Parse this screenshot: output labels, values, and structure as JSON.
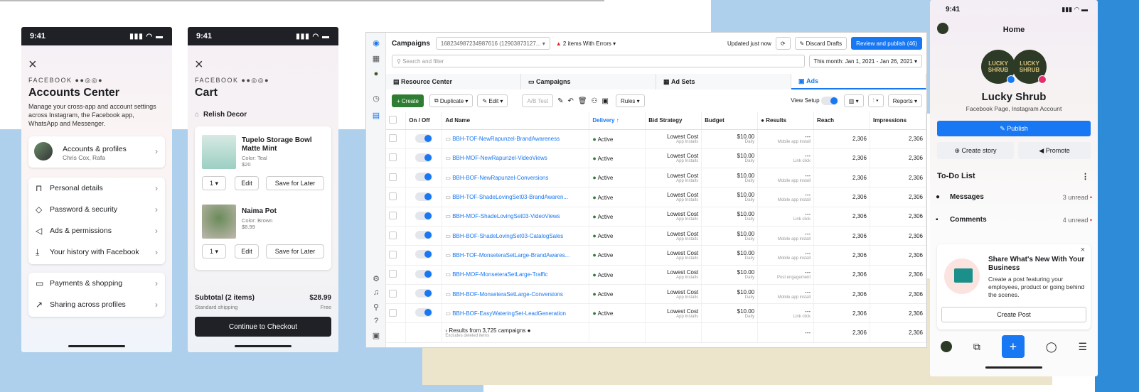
{
  "colors": {
    "accent": "#1877f2",
    "dark": "#1f2126",
    "bg_blue": "#aed0ec",
    "beige": "#ece5cc"
  },
  "phone1": {
    "time": "9:41",
    "brand": "FACEBOOK",
    "title": "Accounts Center",
    "description": "Manage your cross-app and account settings across Instagram, the Facebook app, WhatsApp and Messenger.",
    "profile": {
      "label": "Accounts & profiles",
      "sub": "Chris Cox, Rafa"
    },
    "items": [
      {
        "label": "Personal details",
        "icon": "id-card-icon"
      },
      {
        "label": "Password & security",
        "icon": "shield-icon"
      },
      {
        "label": "Ads & permissions",
        "icon": "megaphone-icon"
      },
      {
        "label": "Your history with Facebook",
        "icon": "download-icon"
      }
    ],
    "items2": [
      {
        "label": "Payments & shopping",
        "icon": "card-icon"
      },
      {
        "label": "Sharing across profiles",
        "icon": "share-icon"
      }
    ]
  },
  "phone2": {
    "time": "9:41",
    "brand": "FACEBOOK",
    "title": "Cart",
    "shop": "Relish Decor",
    "items": [
      {
        "name": "Tupelo Storage Bowl Matte Mint",
        "color": "Color: Teal",
        "price": "$20",
        "qty": "1"
      },
      {
        "name": "Naima Pot",
        "color": "Color: Brown",
        "price": "$8.99",
        "qty": "1"
      }
    ],
    "edit_label": "Edit",
    "save_label": "Save for Later",
    "subtotal_label": "Subtotal (2 items)",
    "subtotal_value": "$28.99",
    "shipping_label": "Standard shipping",
    "shipping_value": "Free",
    "checkout_label": "Continue to Checkout"
  },
  "ads": {
    "campaigns_label": "Campaigns",
    "account_id": "1682349872349876​16 (12903873127...",
    "errors_label": "2 items With Errors",
    "updated_label": "Updated just now",
    "discard_label": "Discard Drafts",
    "publish_label": "Review and publish (46)",
    "search_placeholder": "Search and filter",
    "date_range": "This month: Jan 1, 2021 - Jan 26, 2021",
    "tabs": [
      "Resource Center",
      "Campaigns",
      "Ad Sets",
      "Ads"
    ],
    "create_label": "+ Create",
    "duplicate_label": "Duplicate",
    "edit_label": "Edit",
    "ab_label": "A/B Test",
    "rules_label": "Rules",
    "view_setup_label": "View Setup",
    "reports_label": "Reports",
    "columns": [
      "On / Off",
      "Ad Name",
      "Delivery ↑",
      "Bid Strategy",
      "Budget",
      "Results",
      "Reach",
      "Impressions"
    ],
    "rows": [
      {
        "name": "BBH-TOF-NewRapunzel-BrandAwareness",
        "delivery": "Active",
        "bid": "Lowest Cost",
        "bid_sub": "App Installs",
        "budget": "$10.00",
        "budget_sub": "Daily",
        "results": "---",
        "results_sub": "Mobile app install",
        "reach": "2,306",
        "impr": "2,306"
      },
      {
        "name": "BBH-MOF-NewRapunzel-VideoViews",
        "delivery": "Active",
        "bid": "Lowest Cost",
        "bid_sub": "App Installs",
        "budget": "$10.00",
        "budget_sub": "Daily",
        "results": "---",
        "results_sub": "Link click",
        "reach": "2,306",
        "impr": "2,306"
      },
      {
        "name": "BBH-BOF-NewRapunzel-Conversions",
        "delivery": "Active",
        "bid": "Lowest Cost",
        "bid_sub": "App Installs",
        "budget": "$10.00",
        "budget_sub": "Daily",
        "results": "---",
        "results_sub": "Mobile app install",
        "reach": "2,306",
        "impr": "2,306"
      },
      {
        "name": "BBH-TOF-ShadeLovingSet03-BrandAwaren...",
        "delivery": "Active",
        "bid": "Lowest Cost",
        "bid_sub": "App Installs",
        "budget": "$10.00",
        "budget_sub": "Daily",
        "results": "---",
        "results_sub": "Mobile app install",
        "reach": "2,306",
        "impr": "2,306"
      },
      {
        "name": "BBH-MOF-ShadeLovingSet03-VideoViews",
        "delivery": "Active",
        "bid": "Lowest Cost",
        "bid_sub": "App Installs",
        "budget": "$10.00",
        "budget_sub": "Daily",
        "results": "---",
        "results_sub": "Link click",
        "reach": "2,306",
        "impr": "2,306"
      },
      {
        "name": "BBH-BOF-ShadeLovingSet03-CatalogSales",
        "delivery": "Active",
        "bid": "Lowest Cost",
        "bid_sub": "App Installs",
        "budget": "$10.00",
        "budget_sub": "Daily",
        "results": "---",
        "results_sub": "Mobile app install",
        "reach": "2,306",
        "impr": "2,306"
      },
      {
        "name": "BBH-TOF-MonseteraSetLarge-BrandAwares...",
        "delivery": "Active",
        "bid": "Lowest Cost",
        "bid_sub": "App Installs",
        "budget": "$10.00",
        "budget_sub": "Daily",
        "results": "---",
        "results_sub": "Mobile app install",
        "reach": "2,306",
        "impr": "2,306"
      },
      {
        "name": "BBH-MOF-MonseteraSetLarge-Traffic",
        "delivery": "Active",
        "bid": "Lowest Cost",
        "bid_sub": "App Installs",
        "budget": "$10.00",
        "budget_sub": "Daily",
        "results": "---",
        "results_sub": "Post engagement",
        "reach": "2,306",
        "impr": "2,306"
      },
      {
        "name": "BBH-BOF-MonseteraSetLarge-Conversions",
        "delivery": "Active",
        "bid": "Lowest Cost",
        "bid_sub": "App Installs",
        "budget": "$10.00",
        "budget_sub": "Daily",
        "results": "---",
        "results_sub": "Mobile app install",
        "reach": "2,306",
        "impr": "2,306"
      },
      {
        "name": "BBH-BOF-EasyWateringSet-LeadGeneration",
        "delivery": "Active",
        "bid": "Lowest Cost",
        "bid_sub": "App Installs",
        "budget": "$10.00",
        "budget_sub": "Daily",
        "results": "---",
        "results_sub": "Link click",
        "reach": "2,306",
        "impr": "2,306"
      }
    ],
    "footer": {
      "label": "Results from 3,725 campaigns",
      "sub": "Excludes deleted items",
      "results": "---",
      "reach": "2,306",
      "impr": "2,306"
    }
  },
  "phone3": {
    "time": "9:41",
    "header": "Home",
    "logo_text": "LUCKY SHRUB",
    "page_name": "Lucky Shrub",
    "page_sub": "Facebook Page, Instagram Account",
    "publish_label": "Publish",
    "create_story_label": "Create story",
    "promote_label": "Promote",
    "todo_label": "To-Do List",
    "messages_label": "Messages",
    "messages_count": "3 unread",
    "comments_label": "Comments",
    "comments_count": "4 unread",
    "promo_title": "Share What's New With Your Business",
    "promo_text": "Create a post featuring your employees, product or going behind the scenes.",
    "create_post_label": "Create Post"
  }
}
